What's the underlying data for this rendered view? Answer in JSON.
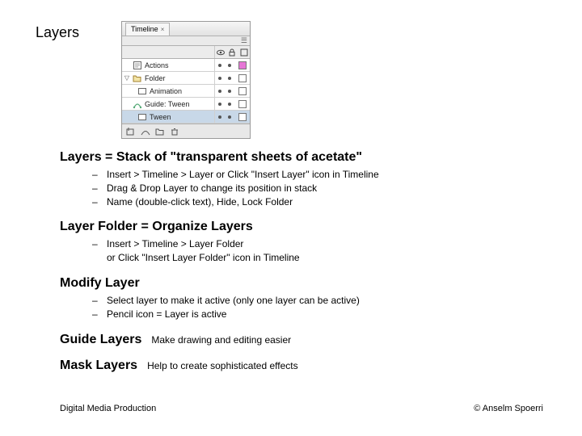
{
  "page_title": "Layers",
  "timeline": {
    "tab_label": "Timeline",
    "rows": [
      {
        "name": "Actions",
        "icon": "script",
        "swatch": "#e676d6",
        "indent": false,
        "arrow": ""
      },
      {
        "name": "Folder",
        "icon": "folder",
        "swatch": "#ffffff",
        "indent": false,
        "arrow": "▽"
      },
      {
        "name": "Animation",
        "icon": "layer",
        "swatch": "#ffffff",
        "indent": true,
        "arrow": ""
      },
      {
        "name": "Guide: Tween",
        "icon": "guide",
        "swatch": "#ffffff",
        "indent": false,
        "arrow": ""
      },
      {
        "name": "Tween",
        "icon": "layer",
        "swatch": "#ffffff",
        "indent": true,
        "arrow": "",
        "selected": true
      }
    ]
  },
  "sections": [
    {
      "heading": "Layers = Stack of \"transparent sheets of acetate\"",
      "bullets": [
        "Insert > Timeline > Layer   or   Click \"Insert Layer\" icon in Timeline",
        "Drag & Drop Layer to change its position in stack",
        "Name (double-click text), Hide, Lock Folder"
      ]
    },
    {
      "heading": "Layer Folder = Organize Layers",
      "bullets": [
        "Insert > Timeline > Layer Folder\nor Click \"Insert Layer Folder\" icon in Timeline"
      ]
    },
    {
      "heading": "Modify Layer",
      "bullets": [
        "Select layer to make it active (only one layer can be active)",
        "Pencil icon = Layer is active"
      ]
    }
  ],
  "inline_sections": [
    {
      "heading": "Guide Layers",
      "desc": "Make drawing and editing easier"
    },
    {
      "heading": "Mask Layers",
      "desc": "Help to create sophisticated effects"
    }
  ],
  "footer": {
    "left": "Digital Media Production",
    "right": "© Anselm Spoerri"
  }
}
